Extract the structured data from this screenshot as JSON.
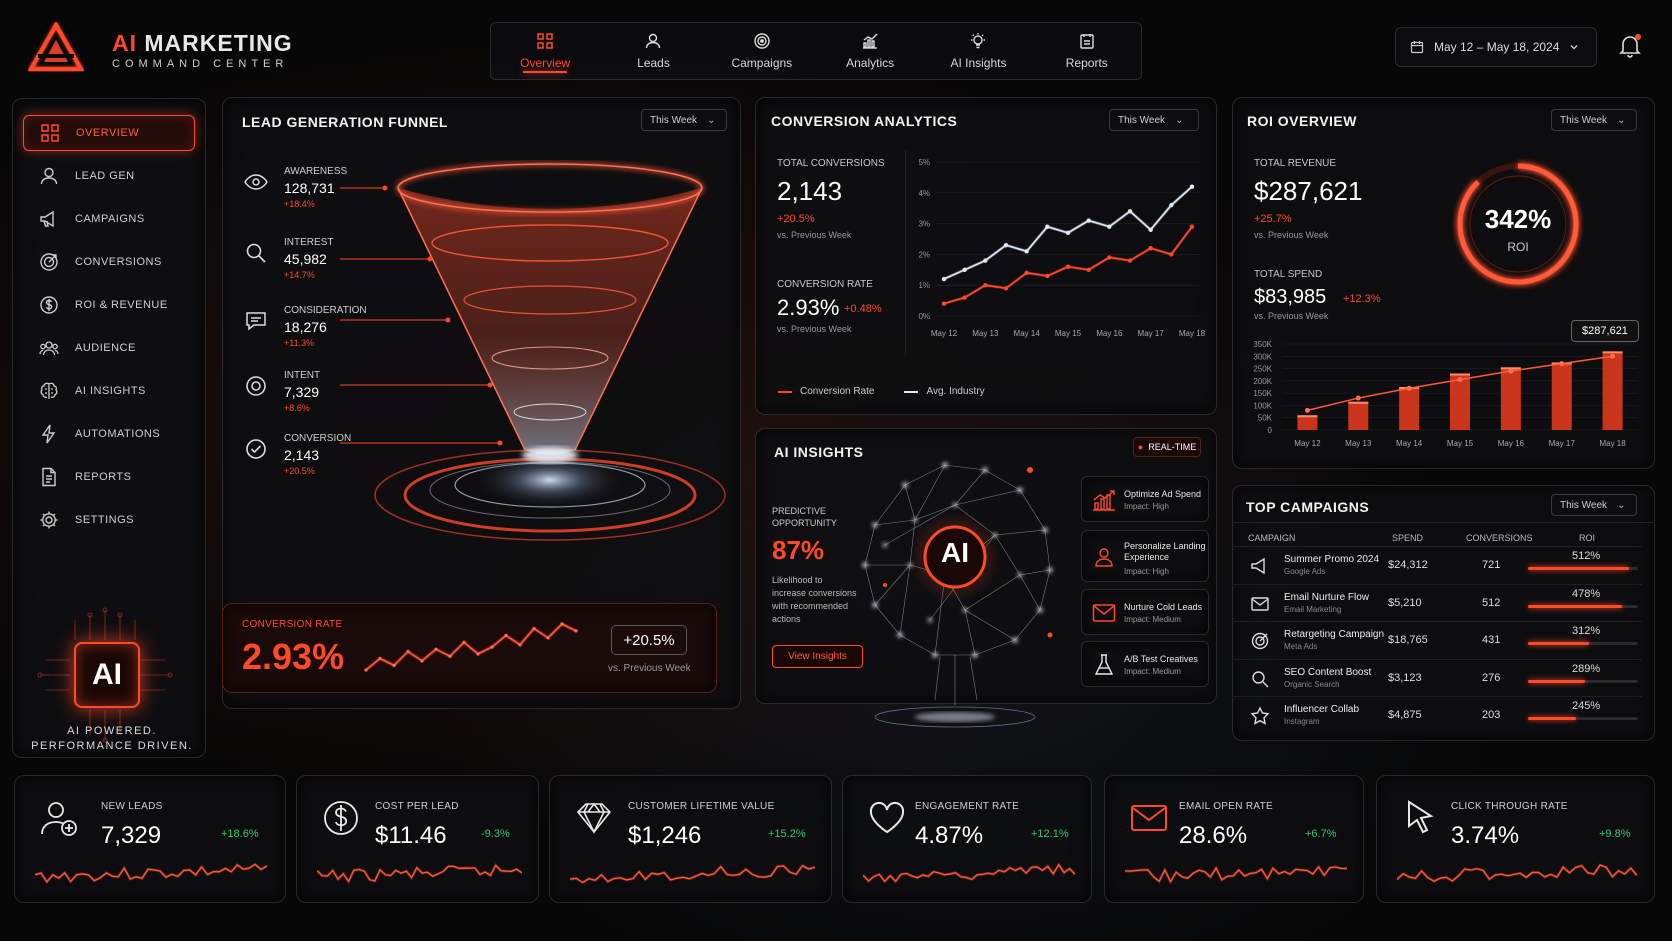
{
  "brand": {
    "title_ai": "AI",
    "title_rest": " MARKETING",
    "subtitle": "COMMAND CENTER"
  },
  "topnav": [
    {
      "label": "Overview",
      "icon": "grid-icon",
      "active": true
    },
    {
      "label": "Leads",
      "icon": "user-icon"
    },
    {
      "label": "Campaigns",
      "icon": "target-icon"
    },
    {
      "label": "Analytics",
      "icon": "chart-icon"
    },
    {
      "label": "AI Insights",
      "icon": "bulb-icon"
    },
    {
      "label": "Reports",
      "icon": "report-icon"
    }
  ],
  "date_range": "May 12 – May 18, 2024",
  "sidebar": {
    "items": [
      {
        "label": "OVERVIEW",
        "icon": "grid-icon",
        "active": true
      },
      {
        "label": "LEAD GEN",
        "icon": "user-icon"
      },
      {
        "label": "CAMPAIGNS",
        "icon": "megaphone-icon"
      },
      {
        "label": "CONVERSIONS",
        "icon": "target-icon"
      },
      {
        "label": "ROI & REVENUE",
        "icon": "dollar-icon"
      },
      {
        "label": "AUDIENCE",
        "icon": "audience-icon"
      },
      {
        "label": "AI INSIGHTS",
        "icon": "brain-icon"
      },
      {
        "label": "AUTOMATIONS",
        "icon": "bolt-icon"
      },
      {
        "label": "REPORTS",
        "icon": "document-icon"
      },
      {
        "label": "SETTINGS",
        "icon": "gear-icon"
      }
    ],
    "chip_label": "AI",
    "tagline_1": "AI POWERED.",
    "tagline_2": "PERFORMANCE DRIVEN."
  },
  "funnel": {
    "title": "LEAD GENERATION FUNNEL",
    "period": "This Week",
    "stages": [
      {
        "label": "AWARENESS",
        "value": "128,731",
        "change": "+18.4%"
      },
      {
        "label": "INTEREST",
        "value": "45,982",
        "change": "+14.7%"
      },
      {
        "label": "CONSIDERATION",
        "value": "18,276",
        "change": "+11.3%"
      },
      {
        "label": "INTENT",
        "value": "7,329",
        "change": "+8.6%"
      },
      {
        "label": "CONVERSION",
        "value": "2,143",
        "change": "+20.5%"
      }
    ],
    "conv_label": "CONVERSION RATE",
    "conv_value": "2.93%",
    "conv_change": "+20.5%",
    "conv_vs": "vs. Previous Week"
  },
  "conversion_analytics": {
    "title": "CONVERSION ANALYTICS",
    "period": "This Week",
    "total_label": "TOTAL CONVERSIONS",
    "total_value": "2,143",
    "total_change": "+20.5%",
    "total_vs": "vs. Previous Week",
    "rate_label": "CONVERSION RATE",
    "rate_value": "2.93%",
    "rate_change": "+0.48%",
    "rate_vs": "vs. Previous Week",
    "legend_1": "Conversion Rate",
    "legend_2": "Avg. Industry"
  },
  "roi": {
    "title": "ROI OVERVIEW",
    "period": "This Week",
    "revenue_label": "TOTAL REVENUE",
    "revenue_value": "$287,621",
    "revenue_change": "+25.7%",
    "revenue_vs": "vs. Previous Week",
    "spend_label": "TOTAL SPEND",
    "spend_value": "$83,985",
    "spend_change": "+12.3%",
    "spend_vs": "vs. Previous Week",
    "roi_value": "342%",
    "roi_label": "ROI",
    "tooltip": "$287,621"
  },
  "ai_insights": {
    "title": "AI INSIGHTS",
    "badge": "REAL-TIME",
    "pred_label_1": "PREDICTIVE",
    "pred_label_2": "OPPORTUNITY",
    "pred_value": "87%",
    "pred_desc_1": "Likelihood to",
    "pred_desc_2": "increase conversions",
    "pred_desc_3": "with recommended",
    "pred_desc_4": "actions",
    "button": "View Insights",
    "core_label": "AI",
    "items": [
      {
        "title": "Optimize Ad Spend",
        "impact": "Impact: High",
        "icon": "bar-chart-icon"
      },
      {
        "title": "Personalize Landing Experience",
        "impact": "Impact: High",
        "icon": "person-icon"
      },
      {
        "title": "Nurture Cold Leads",
        "impact": "Impact: Medium",
        "icon": "mail-icon"
      },
      {
        "title": "A/B Test Creatives",
        "impact": "Impact: Medium",
        "icon": "flask-icon"
      }
    ]
  },
  "top_campaigns": {
    "title": "TOP CAMPAIGNS",
    "period": "This Week",
    "headers": [
      "CAMPAIGN",
      "SPEND",
      "CONVERSIONS",
      "ROI"
    ],
    "rows": [
      {
        "name": "Summer Promo 2024",
        "channel": "Google Ads",
        "spend": "$24,312",
        "conversions": "721",
        "roi": "512%",
        "roi_num": 512,
        "icon": "megaphone-icon"
      },
      {
        "name": "Email Nurture Flow",
        "channel": "Email Marketing",
        "spend": "$5,210",
        "conversions": "512",
        "roi": "478%",
        "roi_num": 478,
        "icon": "mail-icon"
      },
      {
        "name": "Retargeting Campaign",
        "channel": "Meta Ads",
        "spend": "$18,765",
        "conversions": "431",
        "roi": "312%",
        "roi_num": 312,
        "icon": "target-icon"
      },
      {
        "name": "SEO Content Boost",
        "channel": "Organic Search",
        "spend": "$3,123",
        "conversions": "276",
        "roi": "289%",
        "roi_num": 289,
        "icon": "search-icon"
      },
      {
        "name": "Influencer Collab",
        "channel": "Instagram",
        "spend": "$4,875",
        "conversions": "203",
        "roi": "245%",
        "roi_num": 245,
        "icon": "star-icon"
      }
    ]
  },
  "kpis": [
    {
      "label": "NEW LEADS",
      "value": "7,329",
      "change": "+18.6%",
      "icon": "add-user-icon",
      "change_color": "#2ecc71"
    },
    {
      "label": "COST PER LEAD",
      "value": "$11.46",
      "change": "-9.3%",
      "icon": "dollar-icon",
      "change_color": "#2ecc71"
    },
    {
      "label": "CUSTOMER LIFETIME VALUE",
      "value": "$1,246",
      "change": "+15.2%",
      "icon": "diamond-icon",
      "change_color": "#2ecc71"
    },
    {
      "label": "ENGAGEMENT RATE",
      "value": "4.87%",
      "change": "+12.1%",
      "icon": "heart-icon",
      "change_color": "#2ecc71"
    },
    {
      "label": "EMAIL OPEN RATE",
      "value": "28.6%",
      "change": "+6.7%",
      "icon": "mail-icon",
      "change_color": "#2ecc71"
    },
    {
      "label": "CLICK THROUGH RATE",
      "value": "3.74%",
      "change": "+9.8%",
      "icon": "cursor-icon",
      "change_color": "#2ecc71"
    }
  ],
  "chart_data": [
    {
      "type": "line",
      "categories": [
        "May 12",
        "May 13",
        "May 14",
        "May 15",
        "May 16",
        "May 17",
        "May 18"
      ],
      "ylim": [
        0,
        5
      ],
      "yticks": [
        "0%",
        "1%",
        "2%",
        "3%",
        "4%",
        "5%"
      ],
      "series": [
        {
          "name": "Conversion Rate",
          "color": "#ff4a2a",
          "values": [
            0.4,
            0.6,
            1.0,
            0.9,
            1.4,
            1.3,
            1.6,
            1.5,
            1.9,
            1.8,
            2.2,
            2.0,
            2.9
          ]
        },
        {
          "name": "Avg. Industry",
          "color": "#dfe8f5",
          "values": [
            1.2,
            1.5,
            1.8,
            2.3,
            2.1,
            2.9,
            2.7,
            3.1,
            2.9,
            3.4,
            2.8,
            3.6,
            4.2
          ]
        }
      ],
      "grid": true,
      "legend": "bottom"
    },
    {
      "type": "bar",
      "categories": [
        "May 12",
        "May 13",
        "May 14",
        "May 15",
        "May 16",
        "May 17",
        "May 18"
      ],
      "values": [
        60000,
        115000,
        175000,
        230000,
        255000,
        275000,
        320000
      ],
      "trend": [
        80000,
        130000,
        170000,
        205000,
        240000,
        270000,
        300000
      ],
      "ylim": [
        0,
        350000
      ],
      "yticks": [
        "0",
        "50K",
        "100K",
        "150K",
        "200K",
        "250K",
        "300K",
        "350K"
      ],
      "grid": true
    },
    {
      "type": "line",
      "name": "conversion-rate-sparkline",
      "values": [
        2.1,
        2.6,
        2.3,
        2.9,
        2.5,
        3.0,
        2.7,
        3.3,
        2.8,
        3.1,
        3.6,
        3.2,
        3.9,
        3.5,
        4.1,
        3.8
      ]
    }
  ]
}
